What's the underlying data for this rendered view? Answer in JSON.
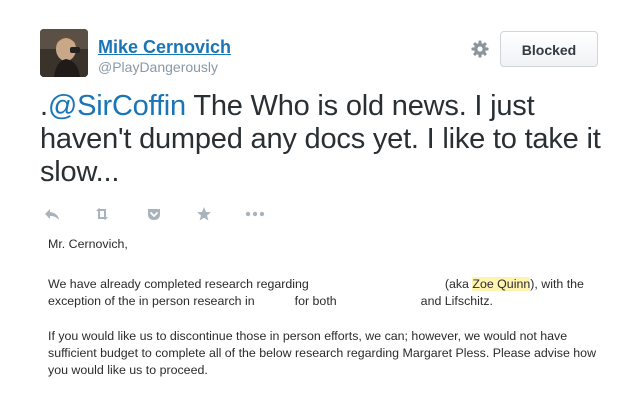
{
  "user": {
    "name": "Mike Cernovich",
    "handle": "@PlayDangerously"
  },
  "header": {
    "blocked_label": "Blocked"
  },
  "tweet": {
    "prefix": ".",
    "mention": "@SirCoffin",
    "text": " The Who is old news. I just haven't dumped any docs yet. I like to take it slow..."
  },
  "actions": [
    "reply-icon",
    "retweet-icon",
    "pocket-icon",
    "favorite-icon",
    "more-icon"
  ],
  "document": {
    "salutation": "Mr. Cernovich,",
    "p1_line1_a": "We have already completed research regarding",
    "p1_line1_b": "(aka",
    "p1_line1_highlight": "Zoe Quinn",
    "p1_line1_c": "), with the",
    "p1_line2_a": "exception of the in person research in",
    "p1_line2_b": "for both",
    "p1_line2_c": "and Lifschitz.",
    "p2_line1": "If you would like us to discontinue those in person efforts, we can; however, we would not have",
    "p2_line2": "sufficient budget to complete all of the below research regarding Margaret Pless.  Please advise how",
    "p2_line3": "you would like us to proceed."
  },
  "colors": {
    "link": "#1a75b7",
    "handle": "#8899a6",
    "icon": "#a8b3bb",
    "highlight": "#fff3b0"
  }
}
